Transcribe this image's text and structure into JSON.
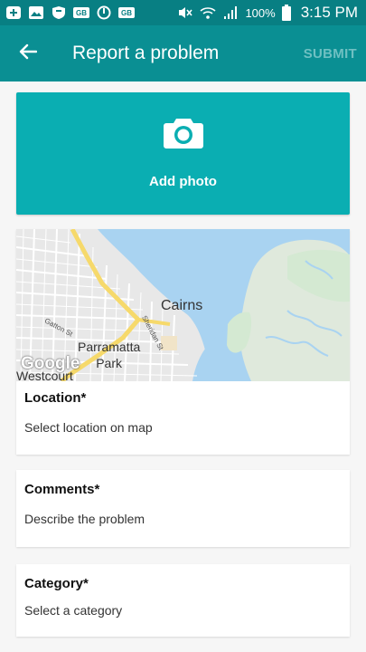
{
  "status_bar": {
    "battery_percent": "100%",
    "time": "3:15 PM",
    "left_icons": [
      "add-icon",
      "image-icon",
      "shield-icon",
      "gb-badge-icon",
      "power-icon",
      "gb-badge-icon"
    ],
    "right_icons": [
      "mute-icon",
      "wifi-icon",
      "signal-icon",
      "battery-icon"
    ]
  },
  "app_bar": {
    "title": "Report a problem",
    "back_icon": "arrow-back-icon",
    "submit_label": "SUBMIT"
  },
  "photo": {
    "label": "Add photo",
    "icon": "camera-icon"
  },
  "map": {
    "city_label": "Cairns",
    "suburb_label_line1": "Parramatta",
    "suburb_label_line2": "Park",
    "street_gatton": "Gatton St",
    "street_sheridan": "Sheridan St",
    "attribution": "Google",
    "partial_label": "Westcourt"
  },
  "location": {
    "title": "Location*",
    "hint": "Select location on map"
  },
  "comments": {
    "title": "Comments*",
    "hint": "Describe the problem"
  },
  "category": {
    "title": "Category*",
    "hint": "Select a category"
  },
  "colors": {
    "status_bar": "#087f83",
    "app_bar": "#0a8f93",
    "photo_card": "#0aaeb2",
    "water": "#a9d3f1",
    "land": "#e8e8e8",
    "park": "#d4e9d2",
    "major_road": "#f6d96b"
  }
}
